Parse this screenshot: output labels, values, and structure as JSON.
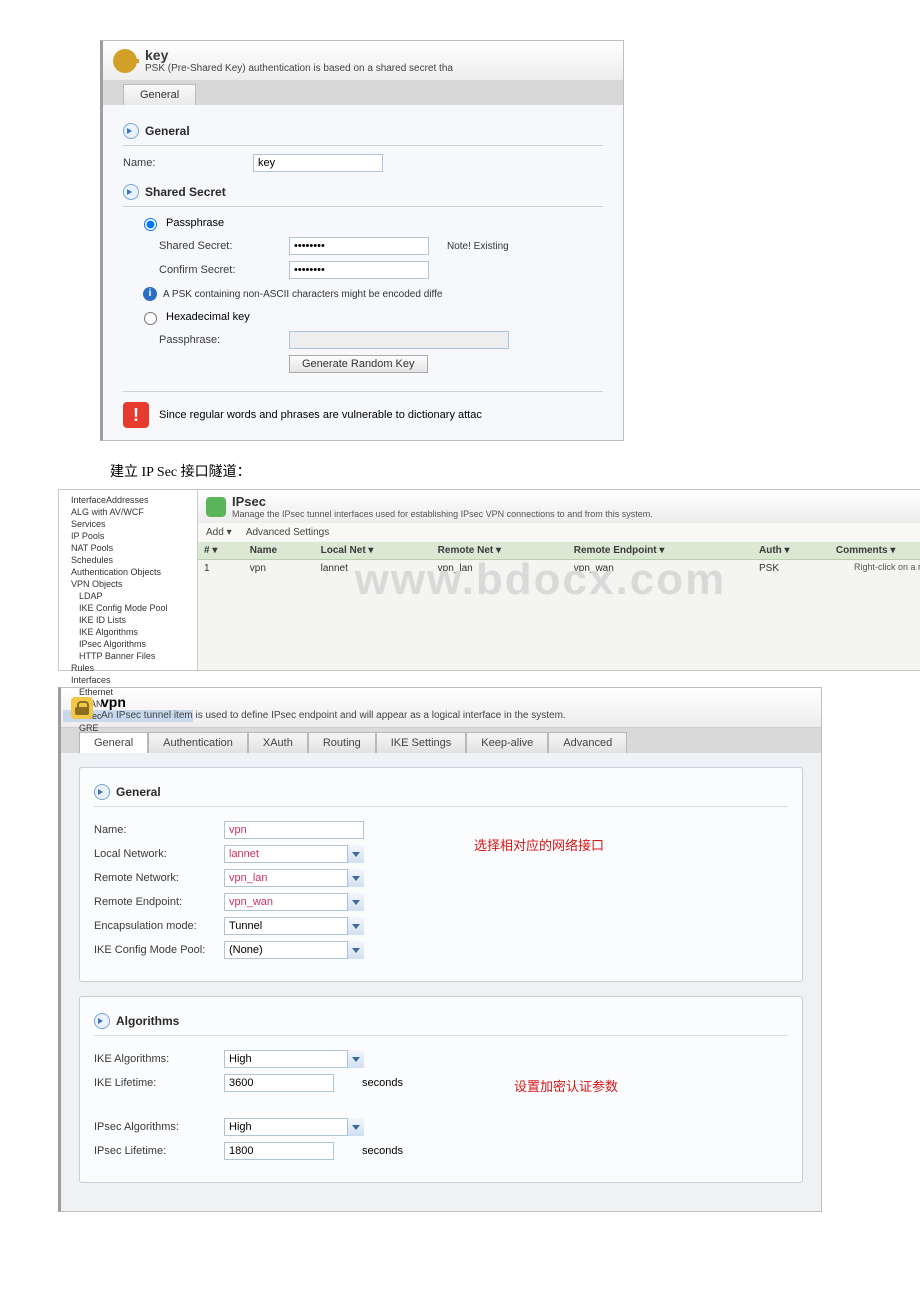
{
  "keyDialog": {
    "title": "key",
    "subtitle": "PSK (Pre-Shared Key) authentication is based on a shared secret tha",
    "tabGeneral": "General",
    "sectionGeneral": "General",
    "nameLabel": "Name:",
    "nameValue": "key",
    "sectionSecret": "Shared Secret",
    "radioPass": "Passphrase",
    "sharedSecretLabel": "Shared Secret:",
    "sharedSecretValue": "••••••••",
    "sharedSecretNote": "Note! Existing",
    "confirmLabel": "Confirm Secret:",
    "confirmValue": "••••••••",
    "asciiNote": "A PSK containing non-ASCII characters might be encoded diffe",
    "radioHex": "Hexadecimal key",
    "passLabel": "Passphrase:",
    "genBtn": "Generate Random Key",
    "warning": "Since regular words and phrases are vulnerable to dictionary attac"
  },
  "cnText1": "建立 IP Sec 接口隧道：",
  "ipsecScreen": {
    "title": "IPsec",
    "subtitle": "Manage the IPsec tunnel interfaces used for establishing IPsec VPN connections to and from this system.",
    "addBtn": "Add ▾",
    "advBtn": "Advanced Settings",
    "col_num": "# ▾",
    "col_name": "Name",
    "col_local": "Local Net ▾",
    "col_remoteNet": "Remote Net ▾",
    "col_remoteEp": "Remote Endpoint ▾",
    "col_auth": "Auth ▾",
    "col_comments": "Comments ▾",
    "row_num": "1",
    "row_name": "vpn",
    "row_local": "lannet",
    "row_remoteNet": "vpn_lan",
    "row_remoteEp": "vpn_wan",
    "row_auth": "PSK",
    "rc": "Right-click on a row for a",
    "watermark": "www.bdocx.com",
    "tree": {
      "n0": "InterfaceAddresses",
      "n1": "ALG with AV/WCF",
      "n2": "Services",
      "n3": "IP Pools",
      "n4": "NAT Pools",
      "n5": "Schedules",
      "n6": "Authentication Objects",
      "n7": "VPN Objects",
      "n8": "LDAP",
      "n9": "IKE Config Mode Pool",
      "n10": "IKE ID Lists",
      "n11": "IKE Algorithms",
      "n12": "IPsec Algorithms",
      "n13": "HTTP Banner Files",
      "n14": "Rules",
      "n15": "Interfaces",
      "n16": "Ethernet",
      "n17": "VLAN",
      "n18": "IPsec",
      "n19": "GRE"
    }
  },
  "vpnDialog": {
    "title": "vpn",
    "subtitle": "An IPsec tunnel item is used to define IPsec endpoint and will appear as a logical interface in the system.",
    "tabs": {
      "general": "General",
      "auth": "Authentication",
      "xauth": "XAuth",
      "routing": "Routing",
      "ike": "IKE Settings",
      "keepalive": "Keep-alive",
      "advanced": "Advanced"
    },
    "secGeneral": "General",
    "nameLabel": "Name:",
    "nameValue": "vpn",
    "localNetLabel": "Local Network:",
    "localNetValue": "lannet",
    "remoteNetLabel": "Remote Network:",
    "remoteNetValue": "vpn_lan",
    "remoteEpLabel": "Remote Endpoint:",
    "remoteEpValue": "vpn_wan",
    "encapLabel": "Encapsulation mode:",
    "encapValue": "Tunnel",
    "ikePoolLabel": "IKE Config Mode Pool:",
    "ikePoolValue": "(None)",
    "redNote1": "选择相对应的网络接口",
    "secAlgo": "Algorithms",
    "ikeAlgoLabel": "IKE Algorithms:",
    "ikeAlgoValue": "High",
    "ikeLifeLabel": "IKE Lifetime:",
    "ikeLifeValue": "3600",
    "ipsecAlgoLabel": "IPsec Algorithms:",
    "ipsecAlgoValue": "High",
    "ipsecLifeLabel": "IPsec Lifetime:",
    "ipsecLifeValue": "1800",
    "seconds": "seconds",
    "redNote2": "设置加密认证参数"
  }
}
